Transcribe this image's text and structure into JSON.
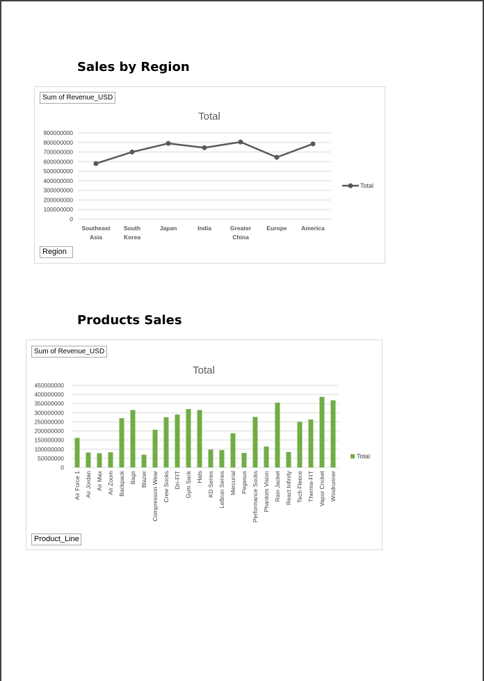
{
  "region_section": {
    "title": "Sales by Region",
    "value_field": "Sum of Revenue_USD",
    "axis_field": "Region"
  },
  "product_section": {
    "title": "Products Sales",
    "value_field": "Sum of Revenue_USD",
    "axis_field": "Product_Line"
  },
  "colors": {
    "line": "#595959",
    "bar": "#70ad47",
    "grid": "#d9d9d9"
  },
  "chart_data": [
    {
      "type": "line",
      "title": "Total",
      "categories": [
        [
          "Southeast",
          "Asia"
        ],
        [
          "South",
          "Korea"
        ],
        [
          "Japan"
        ],
        [
          "India"
        ],
        [
          "Greater",
          "China"
        ],
        [
          "Europe"
        ],
        [
          "America"
        ]
      ],
      "series": [
        {
          "name": "Total",
          "values": [
            580000000,
            700000000,
            790000000,
            745000000,
            805000000,
            645000000,
            785000000
          ]
        }
      ],
      "yticks": [
        "0",
        "100000000",
        "200000000",
        "300000000",
        "400000000",
        "500000000",
        "600000000",
        "700000000",
        "800000000",
        "900000000"
      ],
      "ylim": [
        0,
        900000000
      ],
      "grid": true,
      "legend": "right"
    },
    {
      "type": "bar",
      "title": "Total",
      "categories": [
        "Air Force 1",
        "Air Jordan",
        "Air Max",
        "Air Zoom",
        "Backpack",
        "Bags",
        "Blazer",
        "Compression Wear",
        "Crew Socks",
        "Dri-FIT",
        "Gym Sack",
        "Hats",
        "KD Series",
        "LeBron Series",
        "Mercurial",
        "Pegasus",
        "Performance Socks",
        "Phantom Vision",
        "Rain Jacket",
        "React Infinity",
        "Tech Fleece",
        "Therma-FIT",
        "Vapor Cricket",
        "Windrunner"
      ],
      "series": [
        {
          "name": "Total",
          "values": [
            162000000,
            82000000,
            78000000,
            83000000,
            270000000,
            315000000,
            70000000,
            207000000,
            275000000,
            290000000,
            320000000,
            315000000,
            98000000,
            95000000,
            187000000,
            80000000,
            277000000,
            115000000,
            355000000,
            85000000,
            250000000,
            263000000,
            387000000,
            368000000
          ]
        }
      ],
      "yticks": [
        "0",
        "50000000",
        "100000000",
        "150000000",
        "200000000",
        "250000000",
        "300000000",
        "350000000",
        "400000000",
        "450000000"
      ],
      "ylim": [
        0,
        450000000
      ],
      "grid": true,
      "legend": "right"
    }
  ]
}
